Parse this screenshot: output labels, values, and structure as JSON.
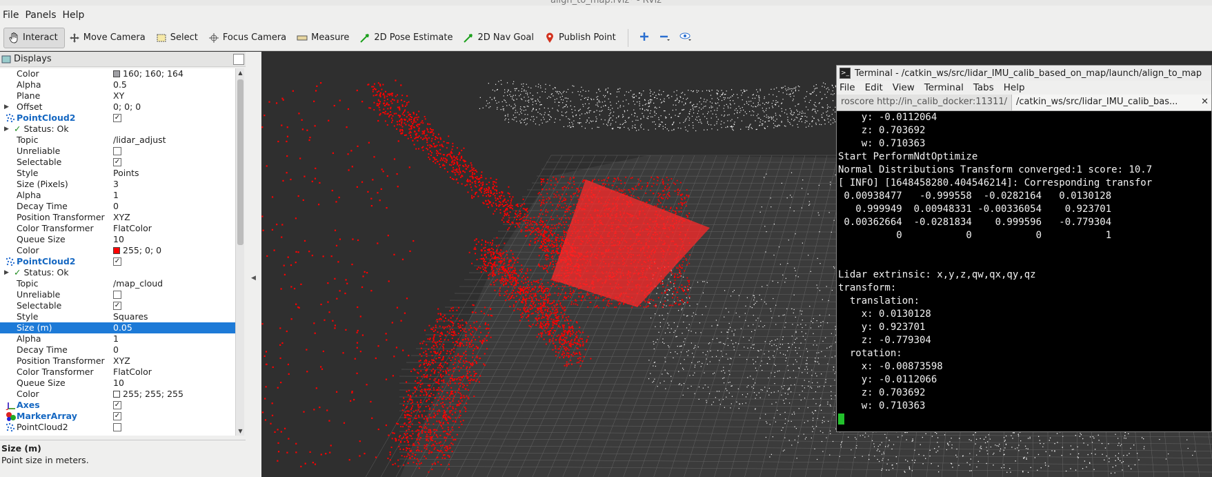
{
  "window": {
    "title": "align_to_map.rviz* - RViz"
  },
  "menu": [
    "File",
    "Panels",
    "Help"
  ],
  "toolbar": {
    "tools": [
      {
        "label": "Interact",
        "icon": "hand-icon"
      },
      {
        "label": "Move Camera",
        "icon": "move-camera-icon"
      },
      {
        "label": "Select",
        "icon": "select-icon"
      },
      {
        "label": "Focus Camera",
        "icon": "focus-camera-icon"
      },
      {
        "label": "Measure",
        "icon": "ruler-icon"
      },
      {
        "label": "2D Pose Estimate",
        "icon": "pose-arrow-icon"
      },
      {
        "label": "2D Nav Goal",
        "icon": "goal-arrow-icon"
      },
      {
        "label": "Publish Point",
        "icon": "map-pin-icon"
      }
    ]
  },
  "displays": {
    "title": "Displays",
    "rows": [
      {
        "type": "prop",
        "k": "Color",
        "v": "160; 160; 164",
        "swatch": "#a0a0a4"
      },
      {
        "type": "prop",
        "k": "Alpha",
        "v": "0.5"
      },
      {
        "type": "prop",
        "k": "Plane",
        "v": "XY"
      },
      {
        "type": "propx",
        "k": "Offset",
        "v": "0; 0; 0"
      },
      {
        "type": "hdr",
        "k": "PointCloud2",
        "check": true,
        "icon": "pointcloud"
      },
      {
        "type": "status",
        "k": "Status: Ok"
      },
      {
        "type": "prop",
        "k": "Topic",
        "v": "/lidar_adjust"
      },
      {
        "type": "prop",
        "k": "Unreliable",
        "check": false
      },
      {
        "type": "prop",
        "k": "Selectable",
        "check": true
      },
      {
        "type": "prop",
        "k": "Style",
        "v": "Points"
      },
      {
        "type": "prop",
        "k": "Size (Pixels)",
        "v": "3"
      },
      {
        "type": "prop",
        "k": "Alpha",
        "v": "1"
      },
      {
        "type": "prop",
        "k": "Decay Time",
        "v": "0"
      },
      {
        "type": "prop",
        "k": "Position Transformer",
        "v": "XYZ"
      },
      {
        "type": "prop",
        "k": "Color Transformer",
        "v": "FlatColor"
      },
      {
        "type": "prop",
        "k": "Queue Size",
        "v": "10"
      },
      {
        "type": "prop",
        "k": "Color",
        "v": "255; 0; 0",
        "swatch": "#ff0000"
      },
      {
        "type": "hdr",
        "k": "PointCloud2",
        "check": true,
        "icon": "pointcloud"
      },
      {
        "type": "status",
        "k": "Status: Ok"
      },
      {
        "type": "prop",
        "k": "Topic",
        "v": "/map_cloud"
      },
      {
        "type": "prop",
        "k": "Unreliable",
        "check": false
      },
      {
        "type": "prop",
        "k": "Selectable",
        "check": true
      },
      {
        "type": "prop",
        "k": "Style",
        "v": "Squares"
      },
      {
        "type": "prop",
        "k": "Size (m)",
        "v": "0.05",
        "selected": true
      },
      {
        "type": "prop",
        "k": "Alpha",
        "v": "1"
      },
      {
        "type": "prop",
        "k": "Decay Time",
        "v": "0"
      },
      {
        "type": "prop",
        "k": "Position Transformer",
        "v": "XYZ"
      },
      {
        "type": "prop",
        "k": "Color Transformer",
        "v": "FlatColor"
      },
      {
        "type": "prop",
        "k": "Queue Size",
        "v": "10"
      },
      {
        "type": "prop",
        "k": "Color",
        "v": "255; 255; 255",
        "swatch": "#ffffff"
      },
      {
        "type": "hdr",
        "k": "Axes",
        "check": true,
        "icon": "axes"
      },
      {
        "type": "hdr",
        "k": "MarkerArray",
        "check": true,
        "icon": "marker"
      },
      {
        "type": "hdrplain",
        "k": "PointCloud2",
        "check": false,
        "icon": "pointcloud"
      }
    ]
  },
  "help": {
    "title": "Size (m)",
    "desc": "Point size in meters."
  },
  "terminal": {
    "title": "Terminal - /catkin_ws/src/lidar_IMU_calib_based_on_map/launch/align_to_map",
    "menu": [
      "File",
      "Edit",
      "View",
      "Terminal",
      "Tabs",
      "Help"
    ],
    "tabs": [
      "roscore http://in_calib_docker:11311/",
      "/catkin_ws/src/lidar_IMU_calib_bas..."
    ],
    "lines": [
      "    y: -0.0112064",
      "    z: 0.703692",
      "    w: 0.710363",
      "Start PerformNdtOptimize",
      "Normal Distributions Transform converged:1 score: 10.7",
      "[ INFO] [1648458280.404546214]: Corresponding transfor",
      " 0.00938477   -0.999558  -0.0282164   0.0130128",
      "   0.999949  0.00948331 -0.00336054    0.923701",
      " 0.00362664  -0.0281834    0.999596   -0.779304",
      "          0           0           0           1",
      "",
      "",
      "Lidar extrinsic: x,y,z,qw,qx,qy,qz",
      "transform:",
      "  translation:",
      "    x: 0.0130128",
      "    y: 0.923701",
      "    z: -0.779304",
      "  rotation:",
      "    x: -0.00873598",
      "    y: -0.0112066",
      "    z: 0.703692",
      "    w: 0.710363"
    ]
  },
  "colors": {
    "selection": "#1d7ad7",
    "display_name": "#1668c2",
    "cloud_red": "#ff0000",
    "cloud_white": "#ffffff",
    "terminal_cursor": "#22c02c"
  }
}
